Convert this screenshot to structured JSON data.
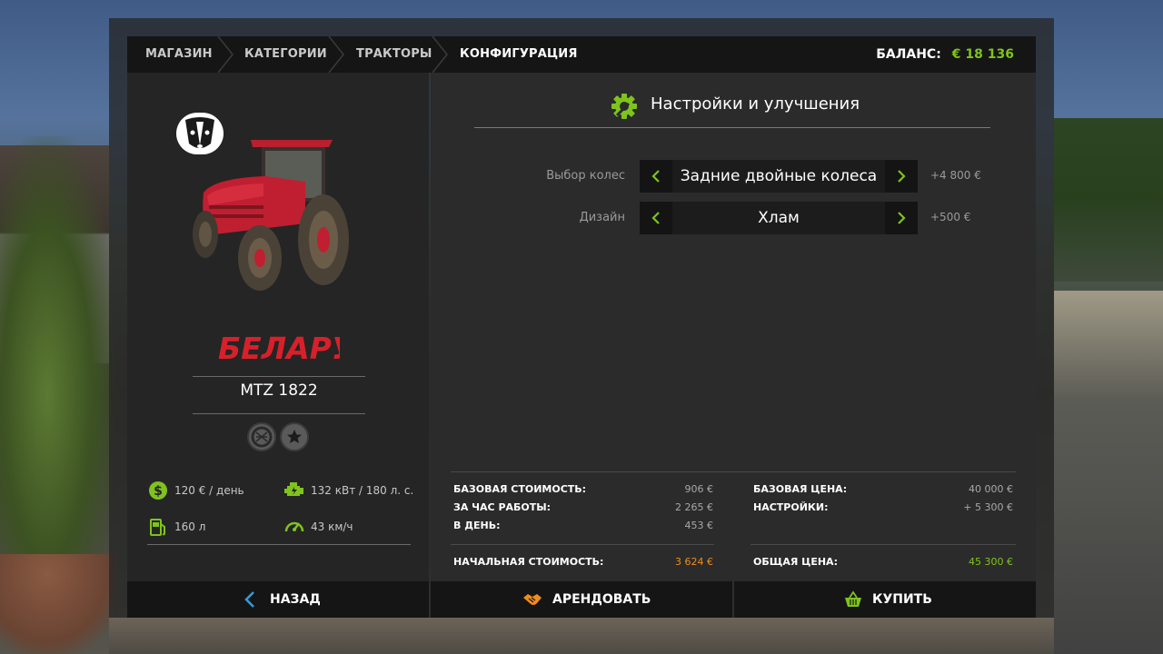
{
  "breadcrumb": {
    "items": [
      {
        "label": "МАГАЗИН"
      },
      {
        "label": "КАТЕГОРИИ"
      },
      {
        "label": "ТРАКТОРЫ"
      },
      {
        "label": "КОНФИГУРАЦИЯ"
      }
    ]
  },
  "balance": {
    "label": "БАЛАНС:",
    "value": "€ 18 136"
  },
  "vehicle": {
    "brand_logo_text": "БЕЛАРУС",
    "model": "MTZ 1822",
    "tags": [
      {
        "icon": "tire-icon"
      },
      {
        "icon": "star-icon"
      }
    ]
  },
  "specs": {
    "maintenance": {
      "icon": "dollar-gear-icon",
      "value": "120 € / день"
    },
    "power": {
      "icon": "engine-icon",
      "value": "132 кВт / 180 л. с."
    },
    "fuel": {
      "icon": "fuel-pump-icon",
      "value": "160 л"
    },
    "speed": {
      "icon": "speedometer-icon",
      "value": "43 км/ч"
    }
  },
  "config": {
    "title": "Настройки и улучшения",
    "options": [
      {
        "label": "Выбор колес",
        "value": "Задние двойные колеса",
        "price": "+4 800 €"
      },
      {
        "label": "Дизайн",
        "value": "Хлам",
        "price": "+500 €"
      }
    ]
  },
  "lease": {
    "base_cost": {
      "label": "БАЗОВАЯ СТОИМОСТЬ:",
      "value": "906 €"
    },
    "per_hour": {
      "label": "ЗА ЧАС РАБОТЫ:",
      "value": "2 265 €"
    },
    "per_day": {
      "label": "В ДЕНЬ:",
      "value": "453 €"
    },
    "initial": {
      "label": "НАЧАЛЬНАЯ СТОИМОСТЬ:",
      "value": "3 624 €"
    }
  },
  "purchase": {
    "base_price": {
      "label": "БАЗОВАЯ ЦЕНА:",
      "value": "40 000 €"
    },
    "settings": {
      "label": "НАСТРОЙКИ:",
      "value": "+ 5 300 €"
    },
    "total": {
      "label": "ОБЩАЯ ЦЕНА:",
      "value": "45 300 €"
    }
  },
  "actions": {
    "back": "НАЗАД",
    "lease": "АРЕНДОВАТЬ",
    "buy": "КУПИТЬ"
  },
  "colors": {
    "accent_green": "#7fc31d",
    "accent_orange": "#f08c1e",
    "accent_blue": "#3a9ad9",
    "panel_dark": "#151515"
  }
}
